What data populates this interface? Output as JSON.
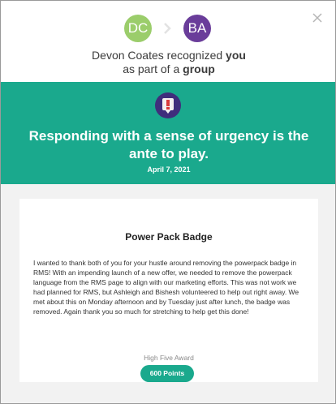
{
  "window": {
    "close_label": "close"
  },
  "giver": {
    "initials": "DC",
    "color": "#9bcd6b"
  },
  "receiver": {
    "initials": "BA",
    "color": "#6a3d9a"
  },
  "recognition": {
    "giver_name": "Devon Coates",
    "verb": "recognized",
    "target": "you",
    "line2_prefix": "as part of a",
    "line2_bold": "group"
  },
  "banner": {
    "color": "#1aa98d",
    "icon": "urgency-flag-icon",
    "value_title": "Responding with a sense of urgency is the ante to play.",
    "date": "April 7, 2021"
  },
  "card": {
    "title": "Power Pack Badge",
    "message": "I wanted to thank both of you for your hustle around removing the powerpack badge in RMS! With an impending launch of a new offer, we needed to remove the powerpack language from the RMS page to align with our marketing efforts. This was not work we had planned for RMS, but Ashleigh and Bishesh volunteered to help out right away. We met about this on Monday afternoon and by Tuesday just after lunch, the badge was removed. Again thank you so much for stretching to help get this done!",
    "award_type": "High Five Award",
    "points": "600 Points"
  }
}
